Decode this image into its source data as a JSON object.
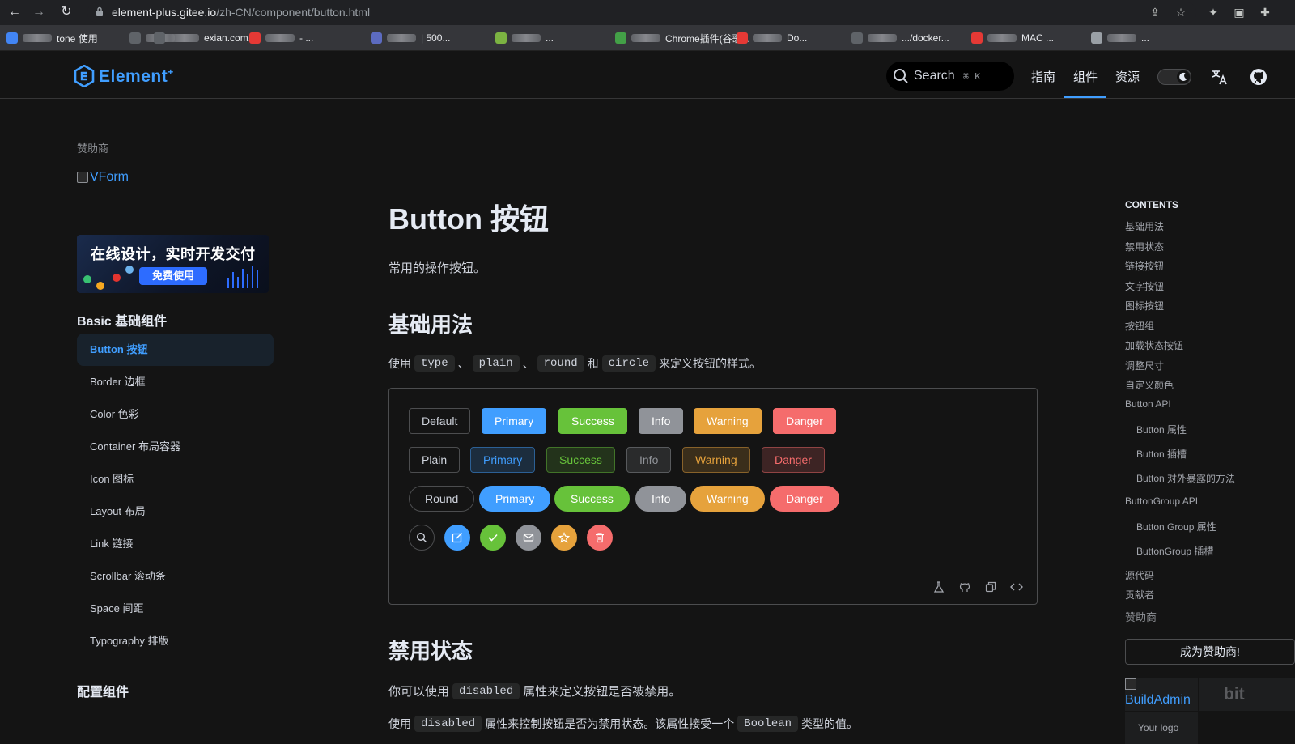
{
  "browser": {
    "url_host": "element-plus.gitee.io",
    "url_path": "/zh-CN/component/button.html",
    "bookmarks": [
      {
        "label": "tone 使用",
        "color": "#4285f4"
      },
      {
        "label": "",
        "color": "#5f6368"
      },
      {
        "label": "exian.com...",
        "color": "#5f6368"
      },
      {
        "label": "- ...",
        "color": "#e53935"
      },
      {
        "label": "| 500...",
        "color": "#5c6bc0"
      },
      {
        "label": "...",
        "color": "#7cb342"
      },
      {
        "label": "Chrome插件(谷歌...",
        "color": "#43a047"
      },
      {
        "label": "Do...",
        "color": "#e53935"
      },
      {
        "label": ".../docker...",
        "color": "#5f6368"
      },
      {
        "label": "MAC ...",
        "color": "#e53935"
      },
      {
        "label": "...",
        "color": "#9aa0a6"
      }
    ]
  },
  "header": {
    "logo": "Element",
    "logo_sup": "+",
    "search_label": "Search",
    "search_kbd": "⌘ K",
    "nav": [
      "指南",
      "组件",
      "资源"
    ],
    "active_nav": "组件"
  },
  "sidebar": {
    "sponsor_title": "赞助商",
    "vform_alt": "VForm",
    "banner_title": "在线设计，实时开发交付",
    "banner_cta": "免费使用",
    "group_basic": "Basic 基础组件",
    "items": [
      "Button 按钮",
      "Border 边框",
      "Color 色彩",
      "Container 布局容器",
      "Icon 图标",
      "Layout 布局",
      "Link 链接",
      "Scrollbar 滚动条",
      "Space 间距",
      "Typography 排版"
    ],
    "active_item": "Button 按钮",
    "group_config": "配置组件"
  },
  "main": {
    "title": "Button 按钮",
    "lead": "常用的操作按钮。",
    "section1_title": "基础用法",
    "section1_text": {
      "prefix": "使用",
      "code1": "type",
      "sep1": "、",
      "code2": "plain",
      "sep2": "、",
      "code3": "round",
      "and": "和",
      "code4": "circle",
      "suffix": "来定义按钮的样式。"
    },
    "demo": {
      "row1": [
        "Default",
        "Primary",
        "Success",
        "Info",
        "Warning",
        "Danger"
      ],
      "row2": [
        "Plain",
        "Primary",
        "Success",
        "Info",
        "Warning",
        "Danger"
      ],
      "row3": [
        "Round",
        "Primary",
        "Success",
        "Info",
        "Warning",
        "Danger"
      ],
      "row4_icons": [
        "search-icon",
        "edit-icon",
        "check-icon",
        "message-icon",
        "star-icon",
        "delete-icon"
      ]
    },
    "section2_title": "禁用状态",
    "section2_text1": {
      "prefix": "你可以使用",
      "code": "disabled",
      "suffix": "属性来定义按钮是否被禁用。"
    },
    "section2_text2": {
      "prefix": "使用",
      "code": "disabled",
      "mid": "属性来控制按钮是否为禁用状态。该属性接受一个",
      "code2": "Boolean",
      "suffix": "类型的值。"
    }
  },
  "colors": {
    "primary": "#409eff",
    "success": "#67c23a",
    "info": "#909399",
    "warning": "#e6a23c",
    "danger": "#f56c6c"
  },
  "toc": {
    "title": "CONTENTS",
    "items": [
      {
        "label": "基础用法",
        "level": 1
      },
      {
        "label": "禁用状态",
        "level": 1
      },
      {
        "label": "链接按钮",
        "level": 1
      },
      {
        "label": "文字按钮",
        "level": 1
      },
      {
        "label": "图标按钮",
        "level": 1
      },
      {
        "label": "按钮组",
        "level": 1
      },
      {
        "label": "加载状态按钮",
        "level": 1
      },
      {
        "label": "调整尺寸",
        "level": 1
      },
      {
        "label": "自定义颜色",
        "level": 1
      },
      {
        "label": "Button API",
        "level": 1
      },
      {
        "label": "Button 属性",
        "level": 2
      },
      {
        "label": "Button 插槽",
        "level": 2
      },
      {
        "label": "Button 对外暴露的方法",
        "level": 2
      },
      {
        "label": "ButtonGroup API",
        "level": 1
      },
      {
        "label": "Button Group 属性",
        "level": 2
      },
      {
        "label": "ButtonGroup 插槽",
        "level": 2
      },
      {
        "label": "源代码",
        "level": 1
      },
      {
        "label": "贡献者",
        "level": 1
      }
    ],
    "sponsor_title": "赞助商",
    "become_sponsor": "成为赞助商!",
    "buildadmin": "BuildAdmin",
    "bit": "bit",
    "your_logo": "Your logo"
  }
}
